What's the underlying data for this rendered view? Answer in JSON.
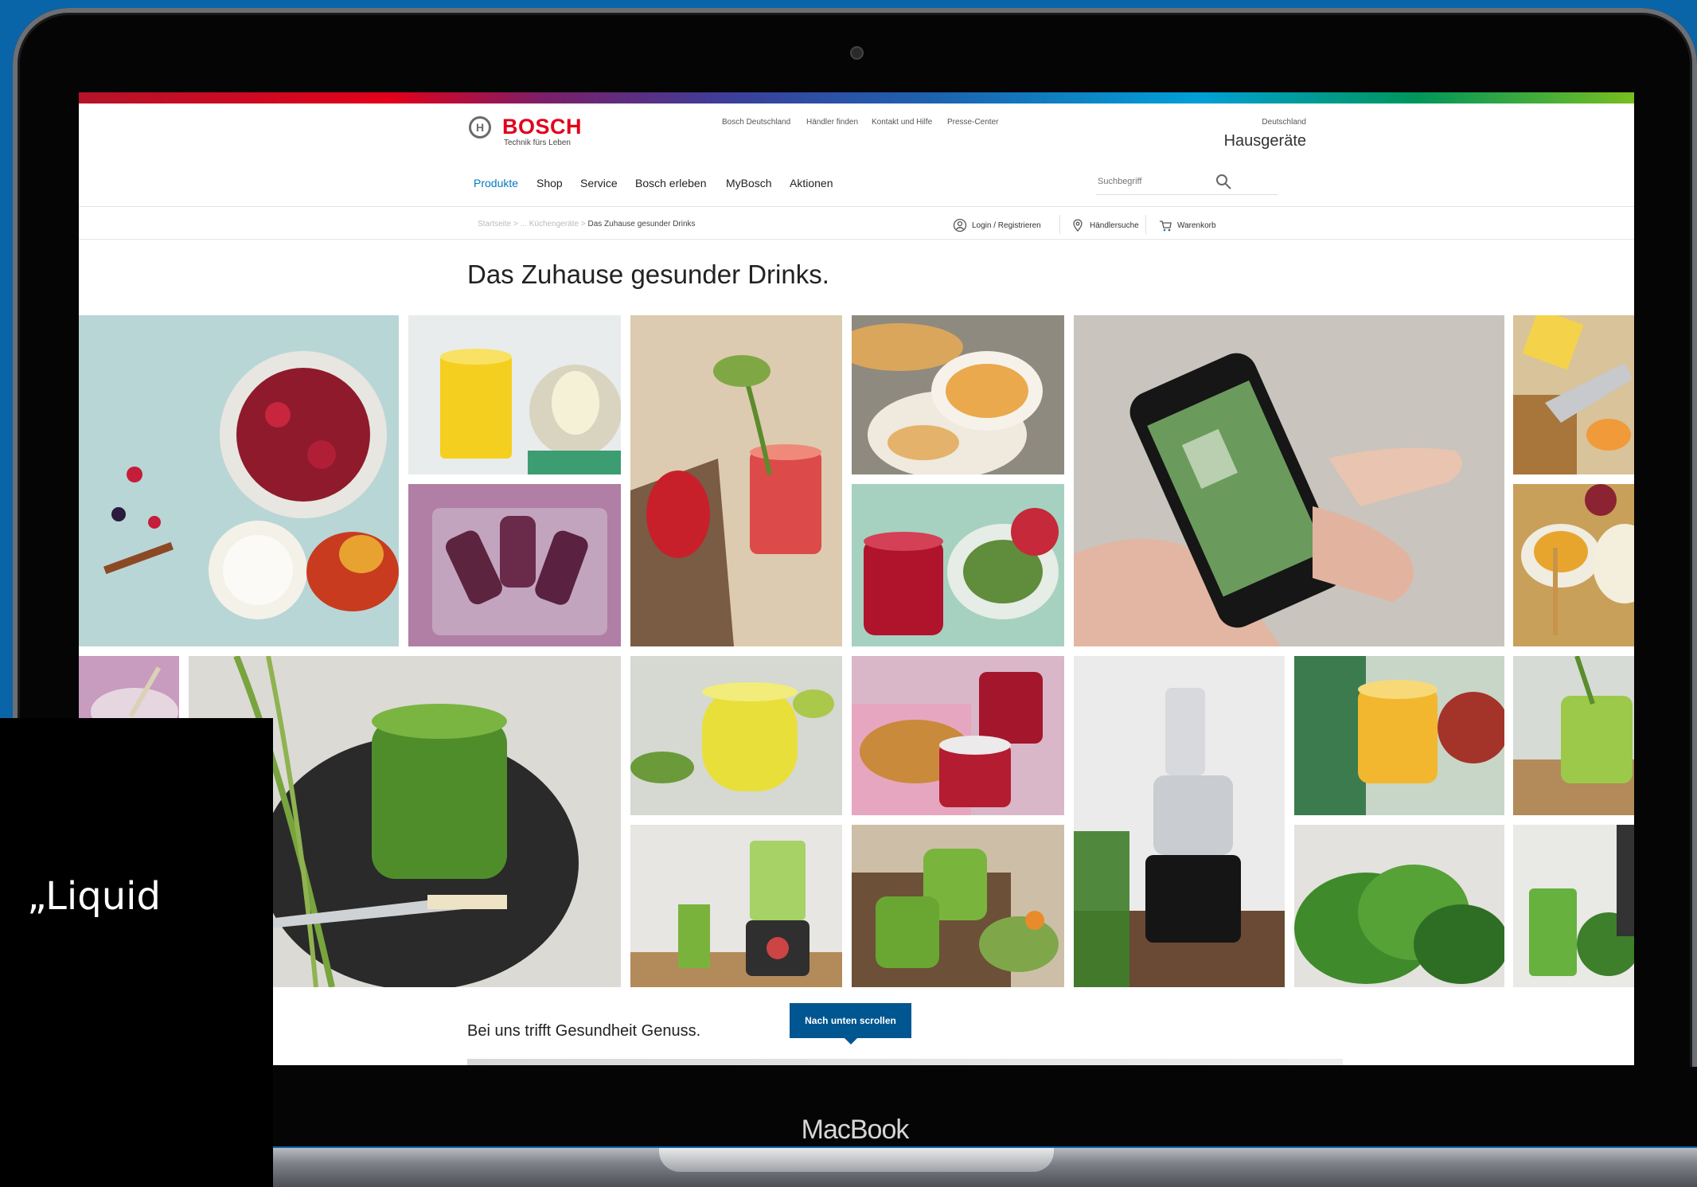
{
  "device": {
    "label": "MacBook"
  },
  "header": {
    "brand": "BOSCH",
    "tagline": "Technik fürs Leben",
    "top_links": [
      "Bosch Deutschland",
      "Händler finden",
      "Kontakt und Hilfe",
      "Presse-Center"
    ],
    "country": "Deutschland",
    "category": "Hausgeräte",
    "nav": [
      "Produkte",
      "Shop",
      "Service",
      "Bosch erleben",
      "MyBosch",
      "Aktionen"
    ],
    "active_nav": "Produkte",
    "search_placeholder": "Suchbegriff"
  },
  "breadcrumb": {
    "items": [
      "Startseite",
      "...",
      "Küchengeräte"
    ],
    "current": "Das Zuhause gesunder Drinks",
    "separator": ">"
  },
  "utility": {
    "login": "Login / Registrieren",
    "dealer": "Händlersuche",
    "cart": "Warenkorb"
  },
  "page": {
    "title": "Das Zuhause gesunder Drinks.",
    "section_title": "Bei uns trifft Gesundheit Genuss.",
    "scroll_button": "Nach unten scrollen"
  },
  "overlay": {
    "text": "„Liquid"
  },
  "colors": {
    "brand_red": "#e2001a",
    "accent_blue": "#007bc0",
    "button_blue": "#005691",
    "background": "#0a64a8"
  },
  "tiles": [
    "berries-yogurt-mango-photo",
    "orange-juice-glass-photo",
    "beet-smoothie-pepper-photo",
    "bread-soup-photo",
    "smartphone-app-photo",
    "fruit-knife-photo",
    "popsicles-photo",
    "red-smoothie-pomegranate-photo",
    "honey-yogurt-photo",
    "green-smoothie-wheatgrass-photo",
    "lemon-juice-photo",
    "croissant-jam-photo",
    "slow-juicer-photo",
    "apple-juice-photo",
    "green-juice-corner-photo",
    "blender-green-smoothie-photo",
    "green-smoothie-glasses-photo",
    "kale-photo",
    "green-juice-right-photo"
  ]
}
